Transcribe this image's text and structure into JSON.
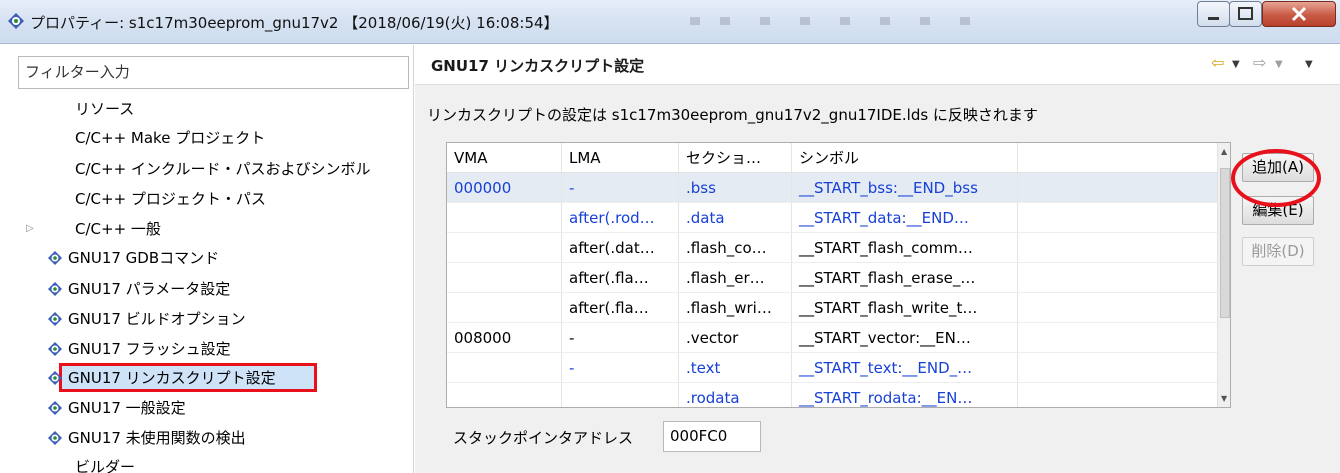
{
  "window": {
    "title": "プロパティー: s1c17m30eeprom_gnu17v2 【2018/06/19(火) 16:08:54】",
    "colors": {
      "close": "#c85a45",
      "title_bg": "#d6e2f2"
    }
  },
  "sidebar": {
    "filter_placeholder": "フィルター入力",
    "items": [
      {
        "label": "リソース",
        "icon": ""
      },
      {
        "label": "C/C++ Make プロジェクト",
        "icon": ""
      },
      {
        "label": "C/C++ インクルード・パスおよびシンボル",
        "icon": ""
      },
      {
        "label": "C/C++ プロジェクト・パス",
        "icon": ""
      },
      {
        "label": "C/C++ 一般",
        "icon": "expander-arrow"
      },
      {
        "label": "GNU17 GDBコマンド",
        "icon": "gnu-icon"
      },
      {
        "label": "GNU17 パラメータ設定",
        "icon": "gnu-icon"
      },
      {
        "label": "GNU17 ビルドオプション",
        "icon": "gnu-icon"
      },
      {
        "label": "GNU17 フラッシュ設定",
        "icon": "gnu-icon"
      },
      {
        "label": "GNU17 リンカスクリプト設定",
        "icon": "gnu-icon",
        "selected": true
      },
      {
        "label": "GNU17 一般設定",
        "icon": "gnu-icon"
      },
      {
        "label": "GNU17 未使用関数の検出",
        "icon": "gnu-icon"
      },
      {
        "label": "ビルダー",
        "icon": ""
      }
    ]
  },
  "main": {
    "title": "GNU17 リンカスクリプト設定",
    "description": "リンカスクリプトの設定は s1c17m30eeprom_gnu17v2_gnu17IDE.lds に反映されます",
    "table": {
      "columns": [
        "VMA",
        "LMA",
        "セクショ…",
        "シンボル"
      ],
      "rows": [
        {
          "vma": "000000",
          "lma": "-",
          "section": ".bss",
          "symbol": "__START_bss:__END_bss",
          "blue": [
            "vma",
            "lma",
            "section",
            "symbol"
          ]
        },
        {
          "vma": "",
          "lma": "after(.rod…",
          "section": ".data",
          "symbol": "__START_data:__END…",
          "blue": [
            "lma",
            "section",
            "symbol"
          ]
        },
        {
          "vma": "",
          "lma": "after(.dat…",
          "section": ".flash_co…",
          "symbol": "__START_flash_comm…",
          "blue": []
        },
        {
          "vma": "",
          "lma": "after(.fla…",
          "section": ".flash_er…",
          "symbol": "__START_flash_erase_…",
          "blue": []
        },
        {
          "vma": "",
          "lma": "after(.fla…",
          "section": ".flash_wri…",
          "symbol": "__START_flash_write_t…",
          "blue": []
        },
        {
          "vma": "008000",
          "lma": "-",
          "section": ".vector",
          "symbol": "__START_vector:__EN…",
          "blue": []
        },
        {
          "vma": "",
          "lma": "-",
          "section": ".text",
          "symbol": "__START_text:__END_…",
          "blue": [
            "lma",
            "section",
            "symbol"
          ]
        },
        {
          "vma": "",
          "lma": "",
          "section": ".rodata",
          "symbol": "__START_rodata:__EN…",
          "blue": [
            "section",
            "symbol"
          ]
        }
      ]
    },
    "buttons": {
      "add": "追加(A)",
      "edit": "編集(E)",
      "delete": "削除(D)"
    },
    "stack": {
      "label": "スタックポインタアドレス",
      "value": "000FC0"
    },
    "nav": {
      "back": "⇦",
      "forward": "⇨",
      "dropdown": "▼",
      "menu": "▼"
    }
  }
}
